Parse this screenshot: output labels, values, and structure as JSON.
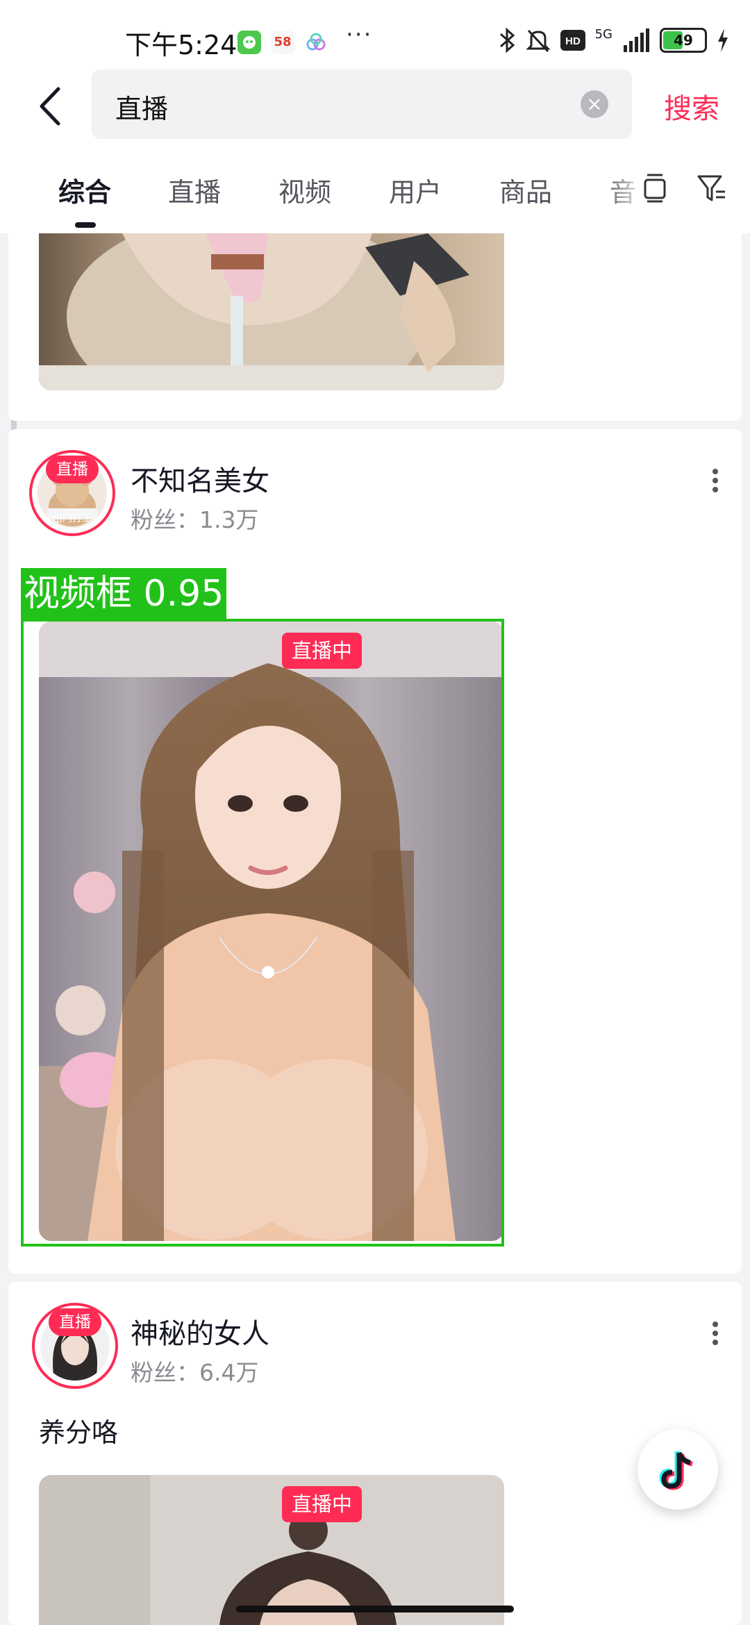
{
  "status_bar": {
    "time": "下午5:24",
    "apps": [
      "58"
    ],
    "network": "5G",
    "battery": "49"
  },
  "search": {
    "query": "直播",
    "submit_label": "搜索"
  },
  "tabs": [
    {
      "label": "综合",
      "active": true
    },
    {
      "label": "直播"
    },
    {
      "label": "视频"
    },
    {
      "label": "用户"
    },
    {
      "label": "商品"
    },
    {
      "label": "音"
    }
  ],
  "feed": [
    {
      "live_tag": "直播",
      "avatar_caption": "出门打工",
      "username": "不知名美女",
      "fans": "粉丝：1.3万",
      "live_badge": "直播中"
    },
    {
      "live_tag": "直播",
      "username": "神秘的女人",
      "fans": "粉丝：6.4万",
      "caption": "养分咯",
      "live_badge": "直播中"
    }
  ],
  "detection": {
    "label": "视频框 0.95"
  },
  "colors": {
    "accent": "#fe2c55",
    "detection": "#22c11a"
  },
  "icons": [
    "back-icon",
    "clear-icon",
    "multiwindow-icon",
    "filter-icon",
    "more-icon",
    "tiktok-icon"
  ]
}
